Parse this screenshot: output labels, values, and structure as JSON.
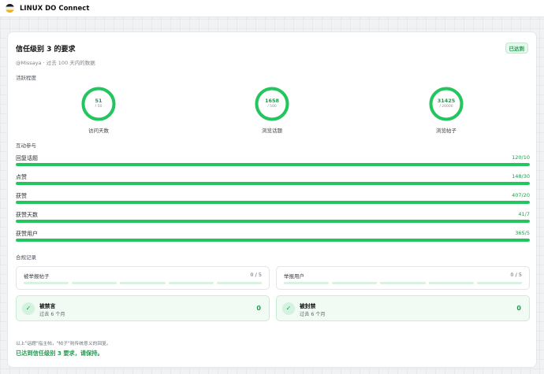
{
  "header": {
    "brand": "LINUX DO Connect"
  },
  "card": {
    "title": "信任级别 3 的要求",
    "badge": "已达到",
    "subtitle": "@Missaya · 过去 100 天内的数据"
  },
  "sections": {
    "activity": "活跃程度",
    "interaction": "互动参与",
    "compliance": "合规记录"
  },
  "activity_metrics": [
    {
      "value": "51",
      "target": "/ 50",
      "label": "访问天数",
      "progress": 1.0
    },
    {
      "value": "1658",
      "target": "/ 500",
      "label": "浏览话题",
      "progress": 1.0
    },
    {
      "value": "31425",
      "target": "/ 20000",
      "label": "浏览帖子",
      "progress": 1.0
    }
  ],
  "interaction_bars": [
    {
      "label": "回复话题",
      "value": "120/10",
      "progress": 1.0
    },
    {
      "label": "点赞",
      "value": "148/30",
      "progress": 1.0
    },
    {
      "label": "获赞",
      "value": "407/20",
      "progress": 1.0
    },
    {
      "label": "获赞天数",
      "value": "41/7",
      "progress": 1.0
    },
    {
      "label": "获赞用户",
      "value": "365/5",
      "progress": 1.0
    }
  ],
  "reports": [
    {
      "label": "被举报帖子",
      "count": "0 / 5",
      "filled": 0,
      "segments": 5
    },
    {
      "label": "举报用户",
      "count": "0 / 5",
      "filled": 0,
      "segments": 5
    }
  ],
  "bans": [
    {
      "title": "被禁言",
      "sub": "过去 6 个月",
      "count": "0",
      "icon": "check-icon"
    },
    {
      "title": "被封禁",
      "sub": "过去 6 个月",
      "count": "0",
      "icon": "check-icon"
    }
  ],
  "footer": {
    "note": "以上\"话题\"指主帖，\"帖子\"则传统意义的回复。",
    "status": "已达到信任级别 3 要求，请保持。"
  },
  "colors": {
    "accent": "#22c55e",
    "accent_text": "#1a9e4b",
    "track": "#dff3e7"
  }
}
